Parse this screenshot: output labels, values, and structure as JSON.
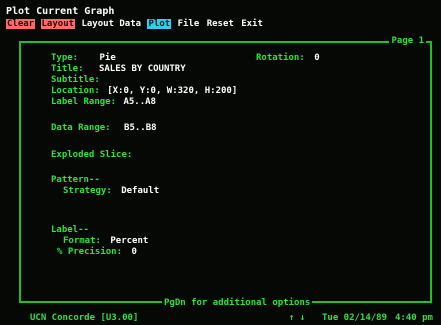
{
  "window": {
    "title": "Plot Current Graph"
  },
  "menu": [
    {
      "label": "Clear",
      "style": "red"
    },
    {
      "label": "Layout",
      "style": "red"
    },
    {
      "label": "Layout Data",
      "style": "plain"
    },
    {
      "label": "Plot",
      "style": "cyan"
    },
    {
      "label": "File",
      "style": "plain"
    },
    {
      "label": "Reset",
      "style": "plain"
    },
    {
      "label": "Exit",
      "style": "plain"
    }
  ],
  "panel": {
    "page_label": "Page 1",
    "bottom_hint": "PgDn for additional options",
    "fields": {
      "type": {
        "label": "Type:",
        "value": "Pie"
      },
      "rotation": {
        "label": "Rotation:",
        "value": "0"
      },
      "title": {
        "label": "Title:",
        "value": "SALES BY COUNTRY"
      },
      "subtitle": {
        "label": "Subtitle:",
        "value": ""
      },
      "location": {
        "label": "Location:",
        "value": "[X:0, Y:0, W:320, H:200]"
      },
      "label_range": {
        "label": "Label Range:",
        "value": "A5..A8"
      },
      "data_range": {
        "label": "Data Range:",
        "value": "B5..B8"
      },
      "exploded_slice": {
        "label": "Exploded Slice:",
        "value": ""
      },
      "pattern": {
        "label": "Pattern--"
      },
      "strategy": {
        "label": "Strategy:",
        "value": "Default"
      },
      "label_section": {
        "label": "Label--"
      },
      "format": {
        "label": "Format:",
        "value": "Percent"
      },
      "precision": {
        "label": "% Precision:",
        "value": "0"
      }
    }
  },
  "status": {
    "app": "UCN Concorde [U3.00]",
    "arrows": "↑ ↓",
    "date": "Tue 02/14/89",
    "time": "4:40 pm"
  },
  "colors": {
    "label_green": "#2fe23c",
    "frame_green": "#1fbf2a",
    "menu_red": "#ff6b6b",
    "menu_cyan": "#2ed1e6",
    "background": "#050805"
  }
}
